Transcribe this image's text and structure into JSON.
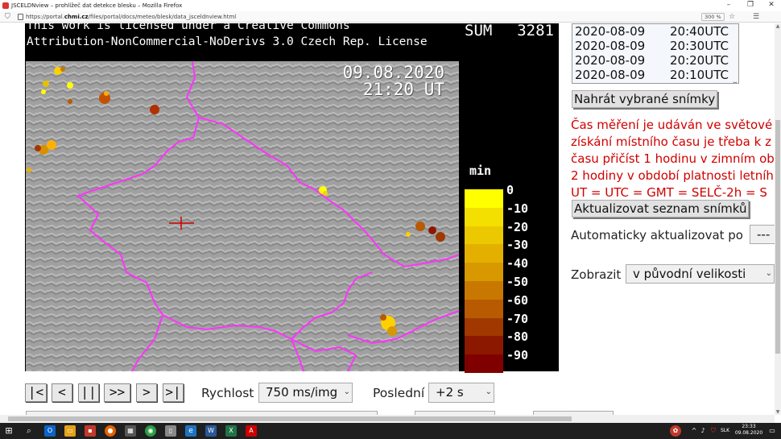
{
  "window": {
    "title": "JSCELDNview – prohlížeč dat detekce blesku – Mozilla Firefox",
    "minimize": "–",
    "maximize": "❐",
    "close": "✕"
  },
  "browser": {
    "url_prefix": "https://portal.",
    "url_domain": "chmi.cz",
    "url_path": "/files/portal/docs/meteo/blesk/data_jsceldnview.html",
    "zoom": "300 %",
    "icons": [
      "shield-icon",
      "lock-icon",
      "star-icon",
      "menu-icon"
    ]
  },
  "panel": {
    "license_line1": "This work is licensed under a Creative Commons",
    "license_line2": "Attribution-NonCommercial-NoDerivs 3.0 Czech Rep. License",
    "sum_label": "SUM",
    "sum_value": "3281",
    "date": "09.08.2020",
    "time": "21:20 UT",
    "legend_unit": "min",
    "legend_labels": [
      "0",
      "-10",
      "-20",
      "-30",
      "-40",
      "-50",
      "-60",
      "-70",
      "-80",
      "-90"
    ],
    "legend_colors": [
      "#ffff00",
      "#f4e000",
      "#ecc800",
      "#e4b000",
      "#d89800",
      "#c87800",
      "#b85a00",
      "#a03800",
      "#8c1800",
      "#800000"
    ]
  },
  "frames": [
    {
      "date": "2020-08-09",
      "time": "20:40UTC"
    },
    {
      "date": "2020-08-09",
      "time": "20:30UTC"
    },
    {
      "date": "2020-08-09",
      "time": "20:20UTC"
    },
    {
      "date": "2020-08-09",
      "time": "20:10UTC"
    }
  ],
  "controls": {
    "load_selected": "Nahrát vybrané snímky",
    "note_lines": [
      "Čas měření je udáván ve světové",
      "získání místního času je třeba k z",
      "času přičíst 1 hodinu v zimním ob",
      "2 hodiny v období platnosti letníh",
      "UT = UTC = GMT = SELČ-2h = S"
    ],
    "refresh_list": "Aktualizovat seznam snímků",
    "auto_refresh_label": "Automaticky aktualizovat po",
    "auto_refresh_value": "---",
    "display_label": "Zobrazit",
    "display_value": "v původní velikosti"
  },
  "playback": {
    "buttons": [
      "|<",
      "<",
      "||",
      ">>",
      ">",
      ">|"
    ],
    "speed_label": "Rychlost",
    "speed_value": "750 ms/img",
    "last_label": "Poslední",
    "last_value": "+2 s"
  },
  "taskbar": {
    "time": "23:33",
    "date": "09.08.2020",
    "lang": "SLK"
  }
}
